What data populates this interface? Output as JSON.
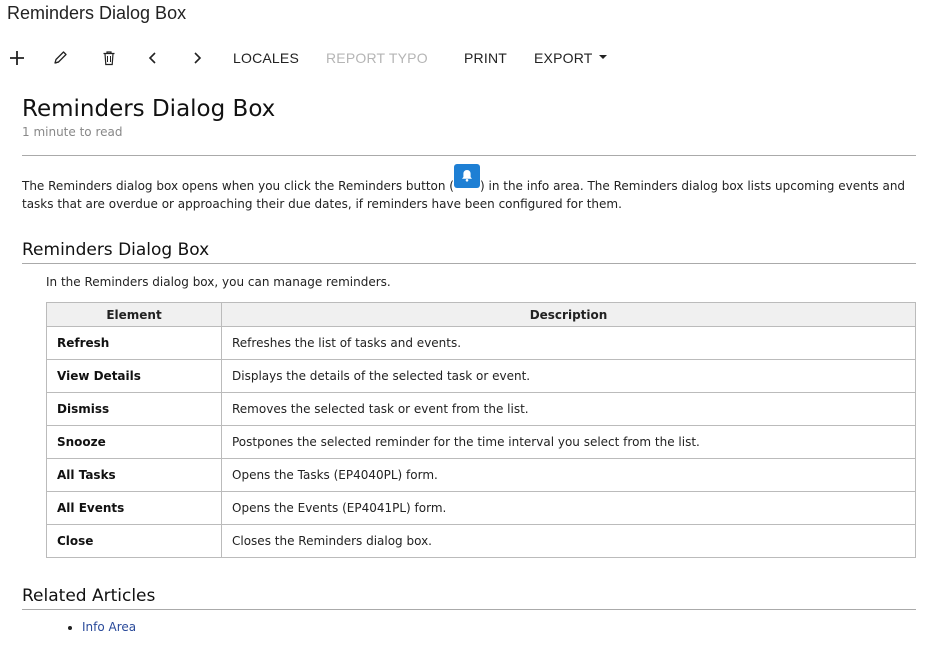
{
  "window": {
    "title": "Reminders Dialog Box"
  },
  "toolbar": {
    "add_icon": "plus-icon",
    "edit_icon": "pencil-icon",
    "delete_icon": "trash-icon",
    "prev_icon": "chevron-left-icon",
    "next_icon": "chevron-right-icon",
    "locales_label": "LOCALES",
    "report_typo_label": "REPORT TYPO",
    "print_label": "PRINT",
    "export_label": "EXPORT"
  },
  "article": {
    "title": "Reminders Dialog Box",
    "read_time": "1 minute to read",
    "intro_before": "The Reminders dialog box opens when you click the Reminders button (",
    "intro_after": ") in the info area. The Reminders dialog box lists upcoming events and tasks that are overdue or approaching their due dates, if reminders have been configured for them.",
    "reminders_button_icon": "bell-icon",
    "accent_color": "#1e7fd4"
  },
  "section": {
    "heading": "Reminders Dialog Box",
    "intro": "In the Reminders dialog box, you can manage reminders.",
    "table": {
      "headers": [
        "Element",
        "Description"
      ],
      "rows": [
        {
          "element": "Refresh",
          "description": "Refreshes the list of tasks and events."
        },
        {
          "element": "View Details",
          "description": "Displays the details of the selected task or event."
        },
        {
          "element": "Dismiss",
          "description": "Removes the selected task or event from the list."
        },
        {
          "element": "Snooze",
          "description": "Postpones the selected reminder for the time interval you select from the list."
        },
        {
          "element": "All Tasks",
          "description": "Opens the Tasks (EP4040PL) form."
        },
        {
          "element": "All Events",
          "description": "Opens the Events (EP4041PL) form."
        },
        {
          "element": "Close",
          "description": "Closes the Reminders dialog box."
        }
      ]
    }
  },
  "related": {
    "heading": "Related Articles",
    "links": [
      "Info Area"
    ],
    "link_color": "#2a4a9a"
  }
}
